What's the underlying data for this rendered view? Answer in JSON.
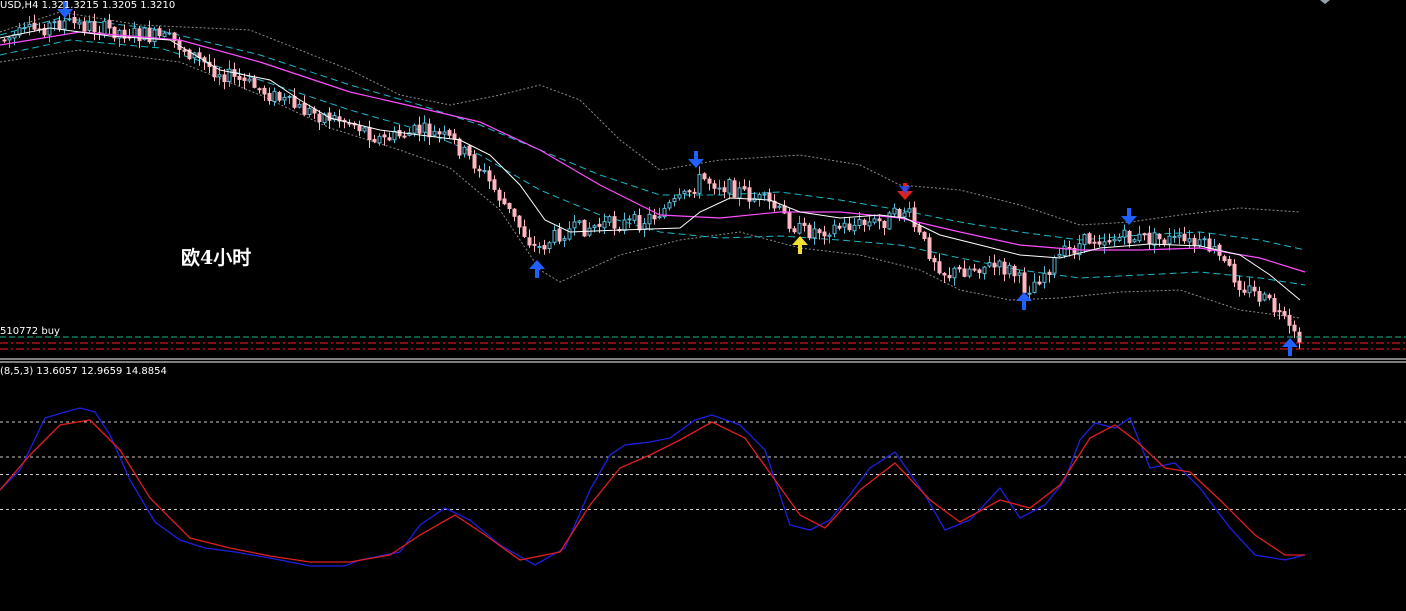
{
  "chart_header": {
    "symbol_tf": "USD,H4",
    "ohlc": "1.32",
    "ohlc_rest": "1.3215 1.3205 1.3210"
  },
  "overlay_text": "欧4小时",
  "order_line": {
    "label": "510772 buy"
  },
  "oscillator": {
    "header": "(8,5,3) 13.6057 12.9659 14.8854"
  },
  "colors": {
    "background": "#000000",
    "bull_candle": "#5bbbd8",
    "bear_candle": "#ffb6c1",
    "ma_white": "#ffffff",
    "ma_magenta": "#ff4dff",
    "envelope_cyan": "#19b9c9",
    "bands_gray": "#8a8a8a",
    "order_red": "#ff2020",
    "order_green": "#1db58a",
    "stoch_main": "#1f1fe0",
    "stoch_signal": "#e01f1f",
    "level_lines": "#c8c8c8",
    "signal_sell": "#e02020",
    "signal_buy": "#2060ff",
    "signal_buy_yellow": "#f0e030"
  },
  "chart_data": [
    {
      "type": "candlestick",
      "title": "USD,H4",
      "signals": [
        {
          "kind": "sell",
          "color": "blue",
          "bar": 12
        },
        {
          "kind": "sell",
          "color": "blue",
          "bar": 137
        },
        {
          "kind": "sell",
          "color": "red",
          "bar": 180
        },
        {
          "kind": "sell",
          "color": "blue",
          "bar": 225
        },
        {
          "kind": "buy",
          "color": "blue",
          "bar": 107
        },
        {
          "kind": "buy",
          "color": "yellow",
          "bar": 159
        },
        {
          "kind": "buy",
          "color": "blue",
          "bar": 204
        },
        {
          "kind": "buy",
          "color": "blue",
          "bar": 257
        }
      ]
    },
    {
      "type": "line",
      "title": "(8,5,3) 13.6057 12.9659 14.8854",
      "levels": [
        80,
        60,
        50,
        30
      ],
      "ylim": [
        0,
        100
      ]
    }
  ]
}
